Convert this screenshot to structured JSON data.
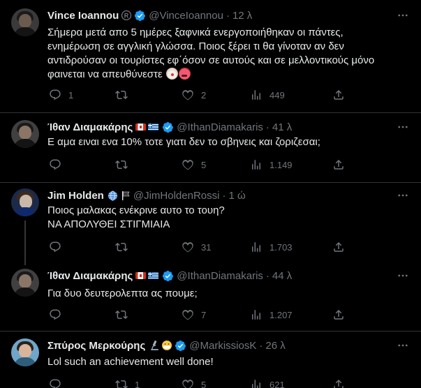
{
  "tweets": [
    {
      "name": "Vince Ioannou",
      "handle": "@VinceIoannou",
      "time": "12 λ",
      "text_lines": [
        "Σήμερα μετά απο 5 ημέρες ξαφνικά ενεργοποιήθηκαν οι πάντες,",
        "ενημέρωση σε αγγλική γλώσσα. Ποιος ξέρει τι θα γίνοταν αν δεν",
        "αντιδρούσαν οι τουρίστες εφ΄όσον σε αυτούς και σε μελλοντικούς μόνο",
        "φαινεται να απευθύνεστε"
      ],
      "replies": "1",
      "retweets": "",
      "likes": "2",
      "views": "449"
    },
    {
      "name": "Ίθαν Διαμακάρης",
      "handle": "@IthanDiamakaris",
      "time": "41 λ",
      "text_lines": [
        "Ε αμα ειναι ενα 10% τοτε γιατι δεν το σβηνεις και ζοριζεσαι;"
      ],
      "replies": "",
      "retweets": "",
      "likes": "5",
      "views": "1.149"
    },
    {
      "name": "Jim Holden",
      "handle": "@JimHoldenRossi",
      "time": "1 ώ",
      "text_lines": [
        "Ποιος μαλακας ενέκρινε αυτο το τουη?",
        "ΝΑ ΑΠΟΛΥΘΕΙ ΣΤΙΓΜΙΑΙΑ"
      ],
      "replies": "",
      "retweets": "",
      "likes": "31",
      "views": "1.703"
    },
    {
      "name": "Ίθαν Διαμακάρης",
      "handle": "@IthanDiamakaris",
      "time": "44 λ",
      "text_lines": [
        "Για δυο δευτερολεπτα ας πουμε;"
      ],
      "replies": "",
      "retweets": "",
      "likes": "7",
      "views": "1.207"
    },
    {
      "name": "Σπύρος Μερκούρης",
      "handle": "@MarkissiosK",
      "time": "26 λ",
      "text_lines": [
        "Lol such an achievement well done!"
      ],
      "replies": "",
      "retweets": "1",
      "likes": "5",
      "views": "621"
    }
  ],
  "separator": "·",
  "colors": {
    "background": "#000000",
    "text": "#e7e9ea",
    "muted": "#71767b",
    "verified": "#1d9bf0",
    "border": "#2f3336"
  }
}
